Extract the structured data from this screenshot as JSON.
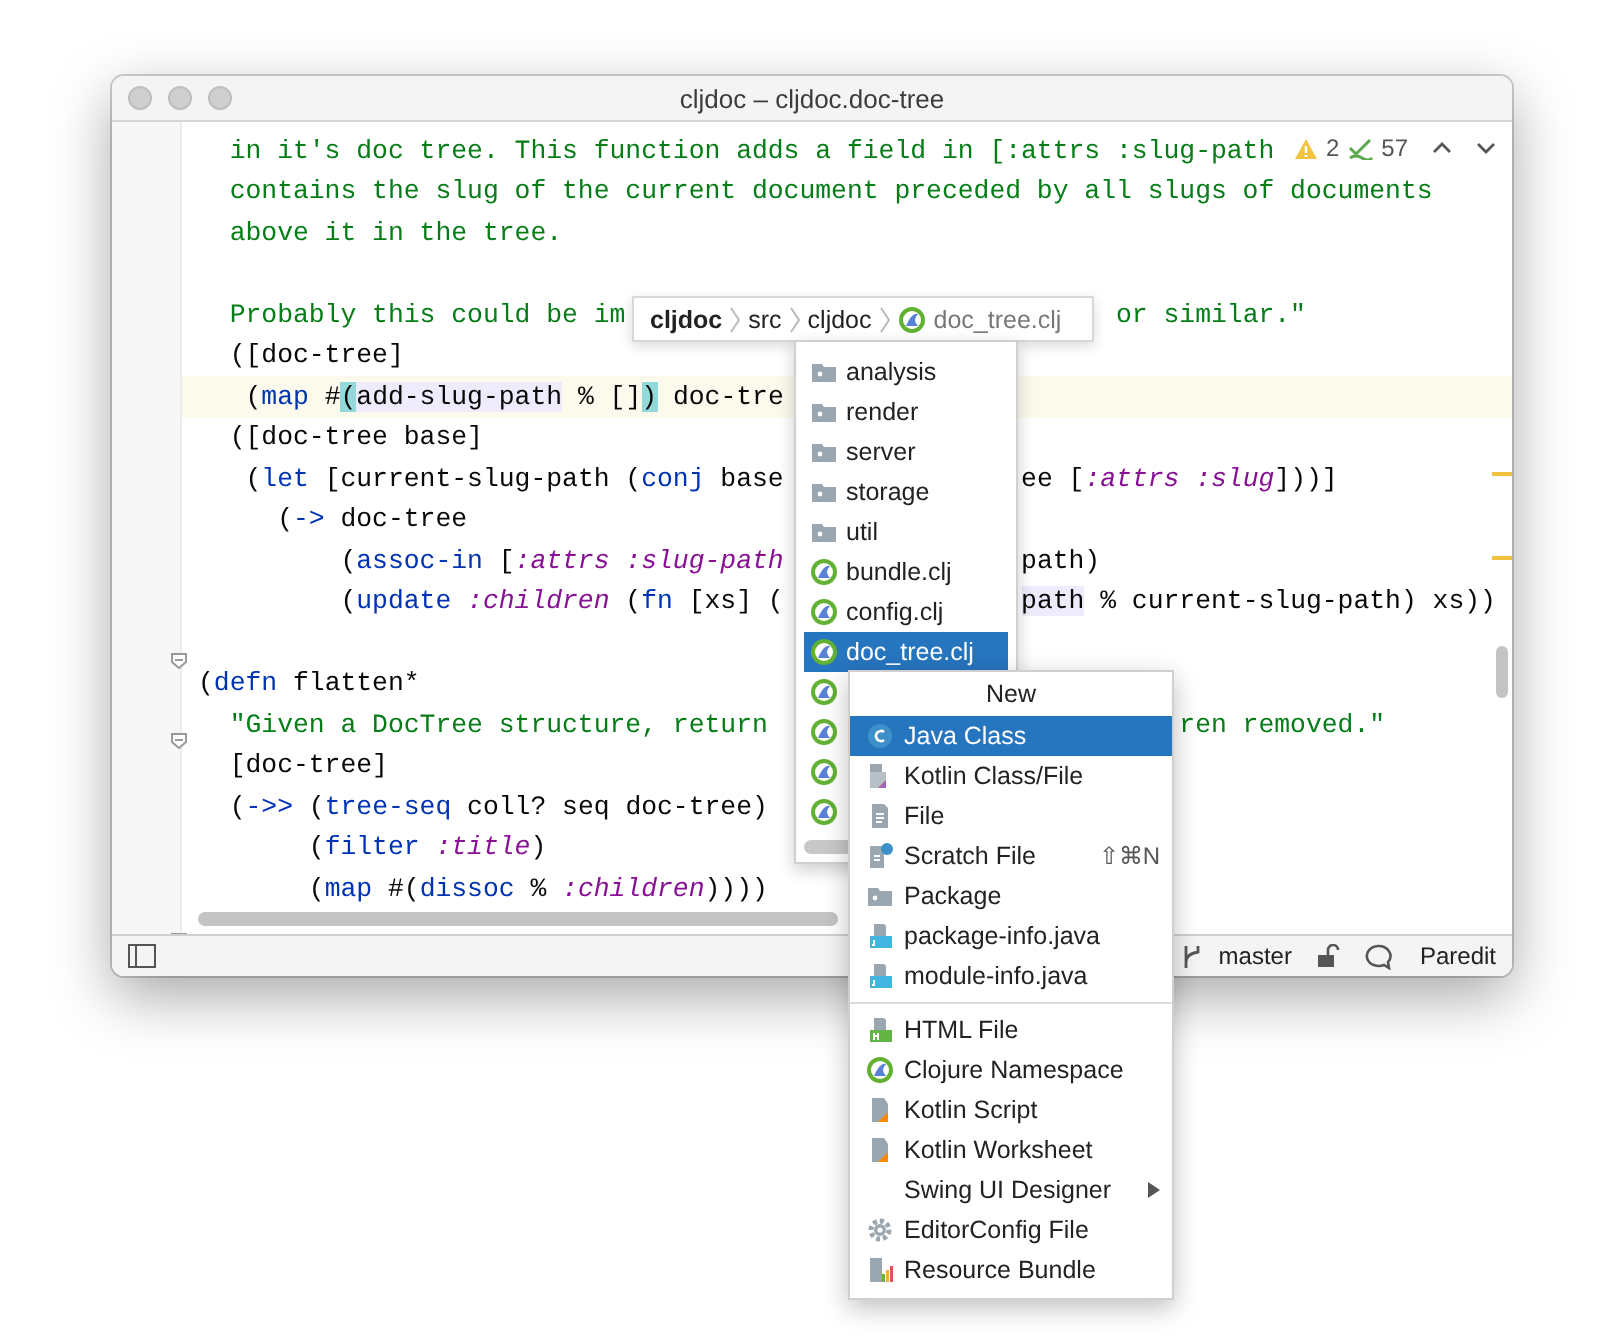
{
  "window": {
    "title": "cljdoc – cljdoc.doc-tree"
  },
  "inspections": {
    "warnings": "2",
    "passed": "57"
  },
  "code": {
    "lines": [
      {
        "current": false,
        "kind": "full",
        "left": [
          {
            "kind": "string",
            "text": "  in it's doc tree. This function adds a field in [:attrs :slug-path"
          }
        ]
      },
      {
        "current": false,
        "kind": "full",
        "left": [
          {
            "kind": "string",
            "text": "  contains the slug of the current document preceded by all slugs of documents"
          }
        ]
      },
      {
        "current": false,
        "kind": "full",
        "left": [
          {
            "kind": "string",
            "text": "  above it in the tree."
          }
        ]
      },
      {
        "current": false,
        "kind": "blank"
      },
      {
        "current": false,
        "kind": "behind-breadcrumb",
        "left": [
          {
            "kind": "string",
            "text": "  Probably this could be im"
          }
        ],
        "right": [
          {
            "kind": "string",
            "text": " or similar.\""
          }
        ]
      },
      {
        "current": false,
        "kind": "full",
        "left": [
          {
            "kind": "plain",
            "text": "  ([doc-tree]"
          }
        ]
      },
      {
        "current": true,
        "kind": "behind-file-list",
        "left": [
          {
            "kind": "plain",
            "text": "   ("
          },
          {
            "kind": "fn",
            "text": "map"
          },
          {
            "kind": "plain",
            "text": " #"
          },
          {
            "kind": "brace",
            "text": "("
          },
          {
            "kind": "usage",
            "text": "add-slug-path"
          },
          {
            "kind": "plain",
            "text": " % []"
          },
          {
            "kind": "brace",
            "text": ")"
          },
          {
            "kind": "plain",
            "text": " doc-tre"
          }
        ]
      },
      {
        "current": false,
        "kind": "full",
        "left": [
          {
            "kind": "plain",
            "text": "  ([doc-tree base]"
          }
        ]
      },
      {
        "current": false,
        "kind": "behind-file-list",
        "left": [
          {
            "kind": "plain",
            "text": "   ("
          },
          {
            "kind": "fn",
            "text": "let"
          },
          {
            "kind": "plain",
            "text": " [current-slug-path ("
          },
          {
            "kind": "fn",
            "text": "conj"
          },
          {
            "kind": "plain",
            "text": " base"
          }
        ],
        "right": [
          {
            "kind": "plain",
            "text": "ee ["
          },
          {
            "kind": "keyword",
            "text": ":attrs :slug"
          },
          {
            "kind": "plain",
            "text": "]))]"
          }
        ]
      },
      {
        "current": false,
        "kind": "full",
        "left": [
          {
            "kind": "plain",
            "text": "     ("
          },
          {
            "kind": "fn",
            "text": "->"
          },
          {
            "kind": "plain",
            "text": " doc-tree"
          }
        ]
      },
      {
        "current": false,
        "kind": "behind-file-list",
        "left": [
          {
            "kind": "plain",
            "text": "         ("
          },
          {
            "kind": "fn",
            "text": "assoc-in"
          },
          {
            "kind": "plain",
            "text": " ["
          },
          {
            "kind": "keyword",
            "text": ":attrs :slug-path"
          }
        ],
        "right": [
          {
            "kind": "plain",
            "text": "path)"
          }
        ]
      },
      {
        "current": false,
        "kind": "behind-file-list",
        "left": [
          {
            "kind": "plain",
            "text": "         ("
          },
          {
            "kind": "fn",
            "text": "update"
          },
          {
            "kind": "keyword",
            "text": " :children"
          },
          {
            "kind": "plain",
            "text": " ("
          },
          {
            "kind": "fn",
            "text": "fn"
          },
          {
            "kind": "plain",
            "text": " [xs] ("
          }
        ],
        "right": [
          {
            "kind": "usage",
            "text": "path"
          },
          {
            "kind": "plain",
            "text": " % current-slug-path) xs))"
          }
        ]
      },
      {
        "current": false,
        "kind": "blank"
      },
      {
        "current": false,
        "kind": "full",
        "left": [
          {
            "kind": "plain",
            "text": "("
          },
          {
            "kind": "fn",
            "text": "defn"
          },
          {
            "kind": "plain",
            "text": " flatten*"
          }
        ]
      },
      {
        "current": false,
        "kind": "behind-menu",
        "left": [
          {
            "kind": "string",
            "text": "  \"Given a DocTree structure, return"
          }
        ],
        "right": [
          {
            "kind": "string",
            "text": "ren removed.\""
          }
        ]
      },
      {
        "current": false,
        "kind": "full",
        "left": [
          {
            "kind": "plain",
            "text": "  [doc-tree]"
          }
        ]
      },
      {
        "current": false,
        "kind": "full",
        "left": [
          {
            "kind": "plain",
            "text": "  ("
          },
          {
            "kind": "fn",
            "text": "->>"
          },
          {
            "kind": "plain",
            "text": " ("
          },
          {
            "kind": "fn",
            "text": "tree-seq"
          },
          {
            "kind": "plain",
            "text": " coll? seq doc-tree)"
          }
        ]
      },
      {
        "current": false,
        "kind": "full",
        "left": [
          {
            "kind": "plain",
            "text": "       ("
          },
          {
            "kind": "fn",
            "text": "filter"
          },
          {
            "kind": "keyword",
            "text": " :title"
          },
          {
            "kind": "plain",
            "text": ")"
          }
        ]
      },
      {
        "current": false,
        "kind": "full",
        "left": [
          {
            "kind": "plain",
            "text": "       ("
          },
          {
            "kind": "fn",
            "text": "map"
          },
          {
            "kind": "plain",
            "text": " #("
          },
          {
            "kind": "fn",
            "text": "dissoc"
          },
          {
            "kind": "plain",
            "text": " %"
          },
          {
            "kind": "keyword",
            "text": " :children"
          },
          {
            "kind": "plain",
            "text": "))))"
          }
        ]
      }
    ]
  },
  "breadcrumb": [
    {
      "label": "cljdoc",
      "kind": "root"
    },
    {
      "label": "src",
      "kind": "dir"
    },
    {
      "label": "cljdoc",
      "kind": "dir"
    },
    {
      "label": "doc_tree.clj",
      "kind": "file"
    }
  ],
  "file_list": {
    "items": [
      {
        "name": "analysis",
        "kind": "folder",
        "selected": false
      },
      {
        "name": "render",
        "kind": "folder",
        "selected": false
      },
      {
        "name": "server",
        "kind": "folder",
        "selected": false
      },
      {
        "name": "storage",
        "kind": "folder",
        "selected": false
      },
      {
        "name": "util",
        "kind": "folder",
        "selected": false
      },
      {
        "name": "bundle.clj",
        "kind": "clojure",
        "selected": false
      },
      {
        "name": "config.clj",
        "kind": "clojure",
        "selected": false
      },
      {
        "name": "doc_tree.clj",
        "kind": "clojure",
        "selected": true
      },
      {
        "kind": "clojure",
        "selected": false
      },
      {
        "kind": "clojure",
        "selected": false
      },
      {
        "kind": "clojure",
        "selected": false
      },
      {
        "kind": "clojure",
        "selected": false
      }
    ]
  },
  "new_menu": {
    "title": "New",
    "groups": [
      [
        {
          "label": "Java Class",
          "kind": "java",
          "selected": true
        },
        {
          "label": "Kotlin Class/File",
          "kind": "kotlin",
          "selected": false
        },
        {
          "label": "File",
          "kind": "file",
          "selected": false
        },
        {
          "label": "Scratch File",
          "kind": "scratch",
          "selected": false,
          "shortcut": "⇧⌘N"
        },
        {
          "label": "Package",
          "kind": "package",
          "selected": false
        },
        {
          "label": "package-info.java",
          "kind": "java-info",
          "selected": false
        },
        {
          "label": "module-info.java",
          "kind": "java-info",
          "selected": false
        }
      ],
      [
        {
          "label": "HTML File",
          "kind": "html",
          "selected": false
        },
        {
          "label": "Clojure Namespace",
          "kind": "clojure",
          "selected": false
        },
        {
          "label": "Kotlin Script",
          "kind": "kotlin-script",
          "selected": false
        },
        {
          "label": "Kotlin Worksheet",
          "kind": "kotlin-script",
          "selected": false
        },
        {
          "label": "Swing UI Designer",
          "kind": "none",
          "selected": false,
          "submenu": true
        },
        {
          "label": "EditorConfig File",
          "kind": "gear",
          "selected": false
        },
        {
          "label": "Resource Bundle",
          "kind": "bundle",
          "selected": false
        }
      ]
    ]
  },
  "status_bar": {
    "branch": "master",
    "mode": "Paredit"
  }
}
